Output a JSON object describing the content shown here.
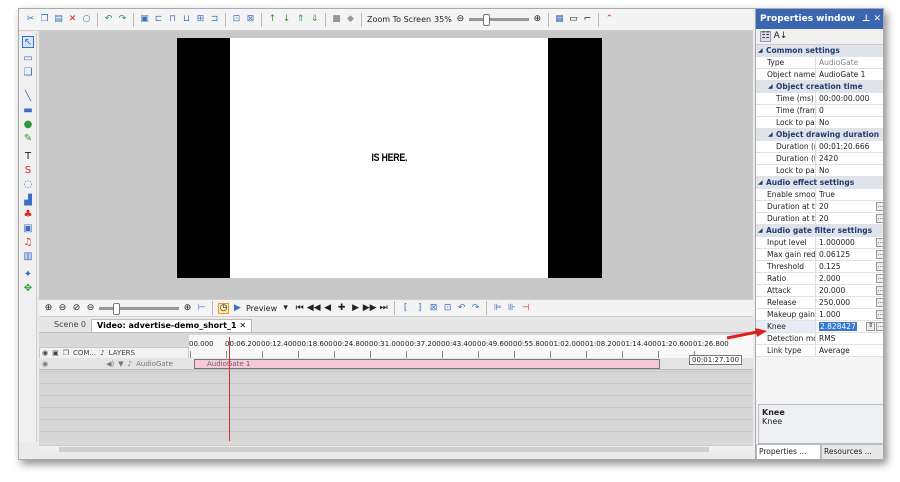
{
  "toolbar": {
    "zoom_to_screen": "Zoom To Screen",
    "zoom_level": "35%"
  },
  "preview": {
    "text": "IS HERE."
  },
  "timeline_toolbar": {
    "preview_label": "Preview"
  },
  "tabs": [
    {
      "label": "Scene 0"
    },
    {
      "label": "Video: advertise-demo_short_1"
    }
  ],
  "timeline": {
    "columns": {
      "com": "COM...",
      "layers": "LAYERS"
    },
    "ruler": [
      "00.000",
      "00:06.200",
      "00:12.400",
      "00:18.600",
      "00:24.800",
      "00:31.000",
      "00:37.200",
      "00:43.400",
      "00:49.600",
      "00:55.800",
      "01:02.000",
      "01:08.200",
      "01:14.400",
      "01:20.600",
      "01:26.800"
    ],
    "track_name": "AudioGate",
    "clip_label": "AudioGate 1",
    "end_time": "00:01:27.100"
  },
  "properties": {
    "title": "Properties window",
    "common": {
      "header": "Common settings",
      "rows": [
        {
          "k": "Type",
          "v": "AudioGate",
          "ro": true
        },
        {
          "k": "Object name",
          "v": "AudioGate 1"
        }
      ]
    },
    "creation": {
      "header": "Object creation time",
      "rows": [
        {
          "k": "Time (ms)",
          "v": "00:00:00.000"
        },
        {
          "k": "Time (frame",
          "v": "0"
        },
        {
          "k": "Lock to pare",
          "v": "No"
        }
      ]
    },
    "drawing": {
      "header": "Object drawing duration",
      "rows": [
        {
          "k": "Duration (m:",
          "v": "00:01:20.666"
        },
        {
          "k": "Duration (fra",
          "v": "2420"
        },
        {
          "k": "Lock to pare",
          "v": "No"
        }
      ]
    },
    "audio": {
      "header": "Audio effect settings",
      "rows": [
        {
          "k": "Enable smooth",
          "v": "True"
        },
        {
          "k": "Duration at the",
          "v": "20"
        },
        {
          "k": "Duration at the",
          "v": "20"
        }
      ]
    },
    "gate": {
      "header": "Audio gate filter settings",
      "rows": [
        {
          "k": "Input level",
          "v": "1.000000"
        },
        {
          "k": "Max gain reduc",
          "v": "0.06125"
        },
        {
          "k": "Threshold",
          "v": "0.125"
        },
        {
          "k": "Ratio",
          "v": "2.000"
        },
        {
          "k": "Attack",
          "v": "20.000"
        },
        {
          "k": "Release",
          "v": "250.000"
        },
        {
          "k": "Makeup gain",
          "v": "1.000"
        },
        {
          "k": "Knee",
          "v": "2.828427"
        },
        {
          "k": "Detection mod",
          "v": "RMS"
        },
        {
          "k": "Link type",
          "v": "Average"
        }
      ]
    },
    "desc_title": "Knee",
    "desc_text": "Knee",
    "bottom_tabs": [
      "Properties ...",
      "Resources ..."
    ]
  },
  "colors": {
    "accent": "#3b66b0",
    "arrow": "#e02020",
    "clip": "#f6c9d7"
  }
}
